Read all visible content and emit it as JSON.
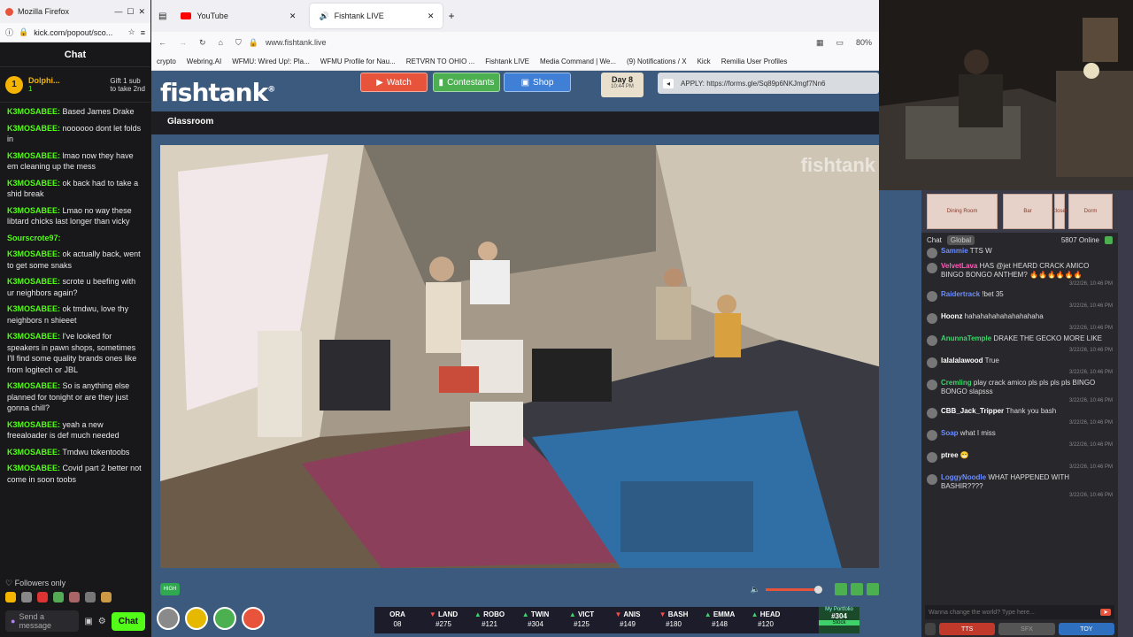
{
  "left_window": {
    "browser_title": "Mozilla Firefox",
    "url": "kick.com/popout/sco...",
    "chat_title": "Chat",
    "pinned": {
      "name": "Dolphi...",
      "count": "1",
      "gift_line1": "Gift 1 sub",
      "gift_line2": "to take 2nd"
    },
    "messages": [
      {
        "user": "K3MOSABEE:",
        "text": "Based James Drake"
      },
      {
        "user": "K3MOSABEE:",
        "text": "noooooo dont let folds in"
      },
      {
        "user": "K3MOSABEE:",
        "text": "lmao now they have em cleaning up the mess"
      },
      {
        "user": "K3MOSABEE:",
        "text": "ok back had to take a shid break"
      },
      {
        "user": "K3MOSABEE:",
        "text": "Lmao no way these libtard chicks last longer than vicky"
      },
      {
        "user": "Sourscrote97:",
        "text": ""
      },
      {
        "user": "K3MOSABEE:",
        "text": "ok actually back, went to get some snaks"
      },
      {
        "user": "K3MOSABEE:",
        "text": "scrote u beefing with ur neighbors again?"
      },
      {
        "user": "K3MOSABEE:",
        "text": "ok tmdwu, love thy neighbors n shieeet"
      },
      {
        "user": "K3MOSABEE:",
        "text": "I've looked for speakers in pawn shops, sometimes I'll find some quality brands ones like from logitech or JBL"
      },
      {
        "user": "K3MOSABEE:",
        "text": "So is anything else planned for tonight or are they just gonna chill?"
      },
      {
        "user": "K3MOSABEE:",
        "text": "yeah a new freealoader is def much needed"
      },
      {
        "user": "K3MOSABEE:",
        "text": "Tmdwu tokentoobs"
      },
      {
        "user": "K3MOSABEE:",
        "text": "Covid part 2 better not come in soon toobs"
      }
    ],
    "followers_only": "Followers only",
    "send_placeholder": "Send a message",
    "chat_button": "Chat"
  },
  "main_window": {
    "tabs": [
      {
        "label": "YouTube"
      },
      {
        "label": "Fishtank LIVE"
      }
    ],
    "address": "www.fishtank.live",
    "zoom": "80%",
    "bookmarks": [
      "crypto",
      "Webring.AI",
      "WFMU: Wired Up!: Pla...",
      "WFMU Profile for Nau...",
      "RETVRN TO OHIO ...",
      "Fishtank LIVE",
      "Media Command | We...",
      "(9) Notifications / X",
      "Kick",
      "Remilia User Profiles"
    ],
    "logo": "fishtank",
    "nav": {
      "watch": "Watch",
      "contestants": "Contestants",
      "shop": "Shop"
    },
    "day": {
      "label": "Day 8",
      "time": "10:44 PM"
    },
    "apply_text": "APPLY: https://forms.gle/Sq89p6NKJmgf7Nn6",
    "room": "Glassroom",
    "watermark": "fishtank",
    "quality": "HIGH",
    "ticker": [
      {
        "name": "ORA",
        "value": "08",
        "dir": "none"
      },
      {
        "name": "LAND",
        "value": "#275",
        "dir": "dn"
      },
      {
        "name": "ROBO",
        "value": "#121",
        "dir": "up"
      },
      {
        "name": "TWIN",
        "value": "#304",
        "dir": "up"
      },
      {
        "name": "VICT",
        "value": "#125",
        "dir": "up"
      },
      {
        "name": "ANIS",
        "value": "#149",
        "dir": "dn"
      },
      {
        "name": "BASH",
        "value": "#180",
        "dir": "dn"
      },
      {
        "name": "EMMA",
        "value": "#148",
        "dir": "up"
      },
      {
        "name": "HEAD",
        "value": "#120",
        "dir": "up"
      }
    ],
    "portfolio": {
      "label": "My Portfolio",
      "value": "#304",
      "stock": "Stock"
    }
  },
  "right_panel": {
    "rooms": [
      "Dining Room",
      "Bar",
      "Closet",
      "Dorm"
    ],
    "chat_label": "Chat",
    "global_label": "Global",
    "online": "5807 Online",
    "messages": [
      {
        "user": "Sammie",
        "text": "TTS W",
        "time": "",
        "color": "#6a8cff"
      },
      {
        "user": "VelvetLava",
        "text": "HAS @jet HEARD CRACK AMICO BINGO BONGO ANTHEM? 🔥🔥🔥🔥🔥🔥",
        "time": "3/22/26, 10:46 PM",
        "color": "#ff5cb8"
      },
      {
        "user": "Raidertrack",
        "text": "!bet 35",
        "time": "3/22/26, 10:46 PM",
        "color": "#6a8cff"
      },
      {
        "user": "Hoonz",
        "text": "hahahahahahahahahaha",
        "time": "3/22/26, 10:46 PM",
        "color": "#ffffff"
      },
      {
        "user": "AnunnaTemple",
        "text": "DRAKE THE GECKO MORE LIKE",
        "time": "3/22/26, 10:46 PM",
        "color": "#3fd26a"
      },
      {
        "user": "lalalalawood",
        "text": "True",
        "time": "3/22/26, 10:46 PM",
        "color": "#ffffff"
      },
      {
        "user": "Cremling",
        "text": "play crack amico pls pls pls pls BINGO BONGO slapsss",
        "time": "3/22/26, 10:46 PM",
        "color": "#3fd26a"
      },
      {
        "user": "CBB_Jack_Tripper",
        "text": "Thank you bash",
        "time": "3/22/26, 10:46 PM",
        "color": "#ffffff"
      },
      {
        "user": "Soap",
        "text": "what I miss",
        "time": "3/22/26, 10:46 PM",
        "color": "#6a8cff"
      },
      {
        "user": "ptree",
        "text": "😁",
        "time": "3/22/26, 10:46 PM",
        "color": "#ffffff"
      },
      {
        "user": "LoggyNoodle",
        "text": "WHAT HAPPENED WITH BASHIR????",
        "time": "3/22/26, 10:46 PM",
        "color": "#6a8cff"
      }
    ],
    "input_placeholder": "Wanna change the world? Type here...",
    "btn_tts": "TTS",
    "btn_sfx": "SFX",
    "btn_toy": "TOY"
  }
}
